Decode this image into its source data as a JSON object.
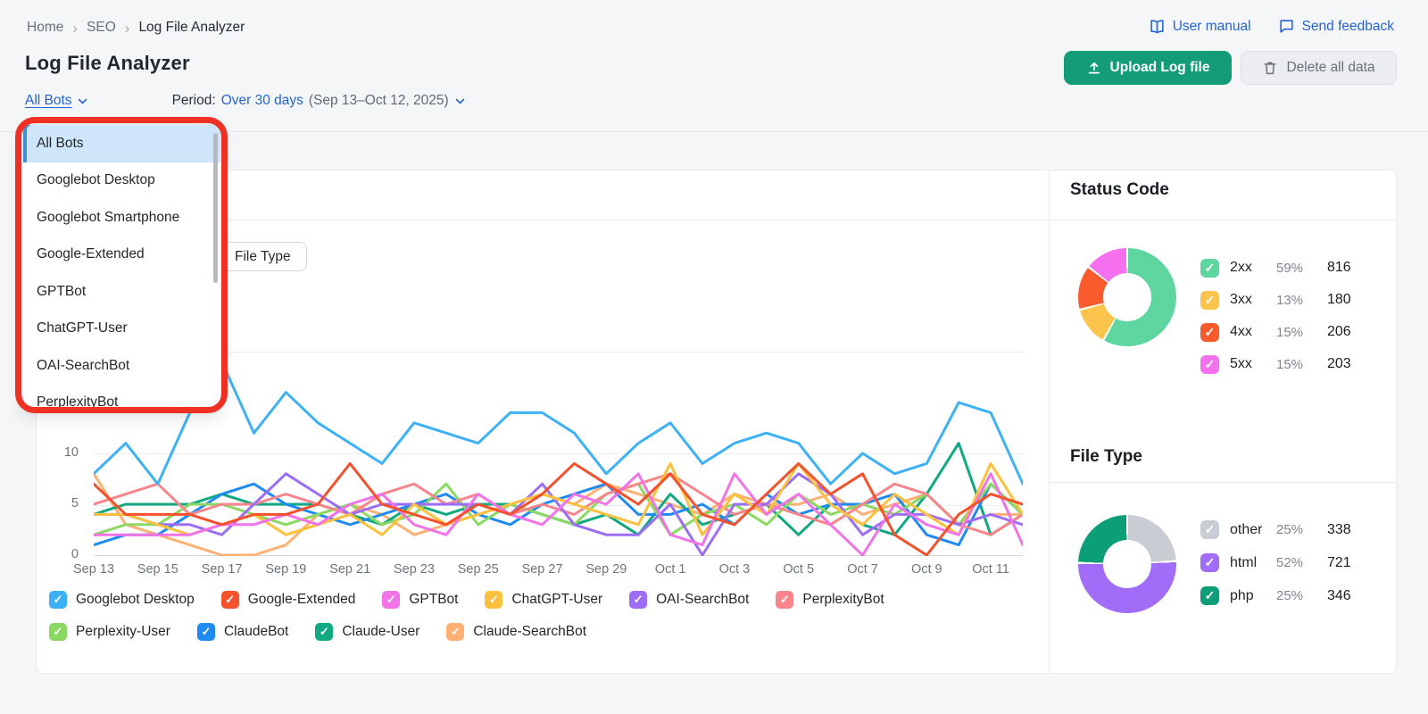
{
  "breadcrumb": {
    "items": [
      "Home",
      "SEO",
      "Log File Analyzer"
    ],
    "separator": "›"
  },
  "header": {
    "title": "Log File Analyzer",
    "user_manual_label": "User manual",
    "send_feedback_label": "Send feedback",
    "upload_button_label": "Upload Log file",
    "delete_button_label": "Delete all data"
  },
  "filters": {
    "bot_selector_value": "All Bots",
    "period_label": "Period:",
    "period_value": "Over 30 days",
    "period_range": "(Sep 13–Oct 12, 2025)"
  },
  "bot_dropdown": {
    "selected": "All Bots",
    "items": [
      "All Bots",
      "Googlebot Desktop",
      "Googlebot Smartphone",
      "Google-Extended",
      "GPTBot",
      "ChatGPT-User",
      "OAI-SearchBot",
      "PerplexityBot"
    ]
  },
  "chart_section": {
    "file_type_chip_label": "File Type"
  },
  "chart_data": {
    "type": "line",
    "title": "",
    "x_tick_labels": [
      "Sep 13",
      "Sep 15",
      "Sep 17",
      "Sep 19",
      "Sep 21",
      "Sep 23",
      "Sep 25",
      "Sep 27",
      "Sep 29",
      "Oct 1",
      "Oct 3",
      "Oct 5",
      "Oct 7",
      "Oct 9",
      "Oct 11"
    ],
    "days": 30,
    "date_range": "Sep 13 – Oct 12, 2025",
    "ylim": [
      0,
      20
    ],
    "yticks": [
      0,
      5,
      10
    ],
    "grid": "horizontal",
    "legend_position": "bottom",
    "series": [
      {
        "name": "Googlebot Desktop",
        "color": "#3DB1F5",
        "values": [
          8,
          11,
          7,
          14,
          19,
          12,
          16,
          13,
          11,
          9,
          13,
          12,
          11,
          14,
          14,
          12,
          8,
          11,
          13,
          9,
          11,
          12,
          11,
          7,
          10,
          8,
          9,
          15,
          14,
          7
        ]
      },
      {
        "name": "Google-Extended",
        "color": "#F4512C",
        "values": [
          7,
          4,
          4,
          4,
          3,
          4,
          4,
          5,
          9,
          5,
          4,
          3,
          5,
          4,
          6,
          9,
          7,
          5,
          8,
          4,
          3,
          6,
          9,
          6,
          8,
          2,
          0,
          4,
          6,
          5
        ]
      },
      {
        "name": "GPTBot",
        "color": "#F272E8",
        "values": [
          2,
          2,
          2,
          2,
          3,
          3,
          4,
          3,
          5,
          6,
          3,
          2,
          6,
          4,
          3,
          6,
          5,
          8,
          2,
          1,
          8,
          4,
          6,
          3,
          0,
          5,
          3,
          2,
          8,
          1
        ]
      },
      {
        "name": "ChatGPT-User",
        "color": "#FBC13C",
        "values": [
          4,
          4,
          3,
          2,
          3,
          4,
          2,
          3,
          4,
          2,
          5,
          3,
          4,
          5,
          6,
          5,
          4,
          3,
          9,
          2,
          6,
          4,
          9,
          5,
          3,
          6,
          4,
          2,
          9,
          4
        ]
      },
      {
        "name": "OAI-SearchBot",
        "color": "#9D6DF5",
        "values": [
          4,
          4,
          3,
          3,
          2,
          5,
          8,
          6,
          4,
          5,
          5,
          5,
          5,
          4,
          7,
          3,
          2,
          2,
          5,
          0,
          5,
          5,
          8,
          6,
          2,
          4,
          4,
          3,
          4,
          3
        ]
      },
      {
        "name": "PerplexityBot",
        "color": "#F9858C",
        "values": [
          5,
          6,
          7,
          4,
          5,
          5,
          6,
          5,
          4,
          6,
          7,
          5,
          6,
          4,
          5,
          4,
          6,
          7,
          8,
          6,
          4,
          5,
          4,
          3,
          5,
          7,
          6,
          3,
          2,
          4
        ]
      },
      {
        "name": "Perplexity-User",
        "color": "#8BD863",
        "values": [
          2,
          3,
          3,
          5,
          5,
          4,
          3,
          4,
          5,
          3,
          4,
          7,
          3,
          5,
          4,
          3,
          6,
          7,
          2,
          4,
          5,
          3,
          6,
          4,
          5,
          4,
          6,
          3,
          7,
          4
        ]
      },
      {
        "name": "ClaudeBot",
        "color": "#1F8BF2",
        "values": [
          1,
          2,
          2,
          4,
          6,
          7,
          5,
          4,
          3,
          4,
          5,
          6,
          4,
          3,
          5,
          6,
          7,
          4,
          4,
          5,
          3,
          6,
          4,
          5,
          5,
          6,
          2,
          1,
          7,
          4
        ]
      },
      {
        "name": "Claude-User",
        "color": "#10A981",
        "values": [
          4,
          5,
          5,
          5,
          6,
          5,
          5,
          5,
          4,
          3,
          5,
          4,
          5,
          5,
          4,
          3,
          4,
          2,
          6,
          3,
          4,
          5,
          2,
          5,
          3,
          2,
          6,
          11,
          2,
          4
        ]
      },
      {
        "name": "Claude-SearchBot",
        "color": "#FFB173",
        "values": [
          8,
          3,
          2,
          1,
          0,
          0,
          1,
          4,
          5,
          4,
          2,
          3,
          4,
          5,
          6,
          5,
          7,
          6,
          5,
          4,
          6,
          5,
          5,
          6,
          4,
          5,
          6,
          3,
          4,
          4
        ]
      }
    ]
  },
  "status_code": {
    "title": "Status Code",
    "chart_type": "donut",
    "legend": [
      {
        "label": "2xx",
        "percent": "59%",
        "count": 816,
        "color": "#5FD6A0"
      },
      {
        "label": "3xx",
        "percent": "13%",
        "count": 180,
        "color": "#FBC44C"
      },
      {
        "label": "4xx",
        "percent": "15%",
        "count": 206,
        "color": "#FA5B2D"
      },
      {
        "label": "5xx",
        "percent": "15%",
        "count": 203,
        "color": "#F470EE"
      }
    ]
  },
  "file_type": {
    "title": "File Type",
    "chart_type": "donut",
    "legend": [
      {
        "label": "other",
        "percent": "25%",
        "count": 338,
        "color": "#C9CCD2"
      },
      {
        "label": "html",
        "percent": "52%",
        "count": 721,
        "color": "#A16CF8"
      },
      {
        "label": "php",
        "percent": "25%",
        "count": 346,
        "color": "#0C9E77"
      }
    ]
  },
  "annotation": {
    "type": "highlight-ring",
    "color": "#EF3123"
  }
}
